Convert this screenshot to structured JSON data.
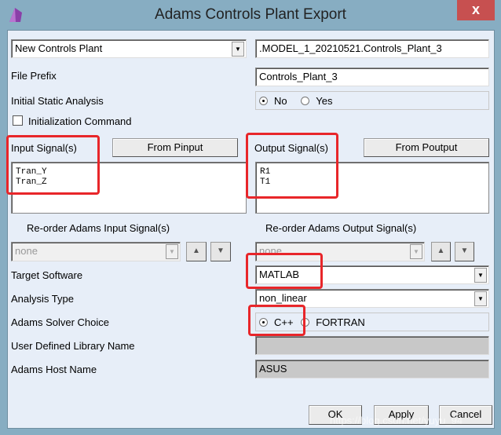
{
  "window": {
    "title": "Adams Controls Plant Export",
    "close_label": "x"
  },
  "plant_selector": {
    "value": "New Controls Plant"
  },
  "plant_name": {
    "value": ".MODEL_1_20210521.Controls_Plant_3"
  },
  "file_prefix": {
    "label": "File Prefix",
    "value": "Controls_Plant_3"
  },
  "initial_static": {
    "label": "Initial Static Analysis",
    "options": [
      "No",
      "Yes"
    ],
    "selected": "No"
  },
  "init_command": {
    "label": "Initialization Command",
    "checked": false
  },
  "input_signals": {
    "label": "Input Signal(s)",
    "button": "From Pinput",
    "items": [
      "Tran_Y",
      "Tran_Z"
    ]
  },
  "output_signals": {
    "label": "Output Signal(s)",
    "button": "From Poutput",
    "items": [
      "R1",
      "T1"
    ]
  },
  "reorder_input": {
    "label": "Re-order Adams Input Signal(s)",
    "value": "none"
  },
  "reorder_output": {
    "label": "Re-order Adams Output Signal(s)",
    "value": "none"
  },
  "target_software": {
    "label": "Target Software",
    "value": "MATLAB"
  },
  "analysis_type": {
    "label": "Analysis Type",
    "value": "non_linear"
  },
  "solver_choice": {
    "label": "Adams Solver Choice",
    "options": [
      "C++",
      "FORTRAN"
    ],
    "selected": "C++"
  },
  "user_library": {
    "label": "User Defined Library Name",
    "value": ""
  },
  "host_name": {
    "label": "Adams Host Name",
    "value": "ASUS"
  },
  "buttons": {
    "ok": "OK",
    "apply": "Apply",
    "cancel": "Cancel"
  },
  "watermark": "https://blog.csdn.net/yuyu_94",
  "colors": {
    "highlight": "#e8262a",
    "titlebar": "#87adc2",
    "close": "#c75050"
  }
}
